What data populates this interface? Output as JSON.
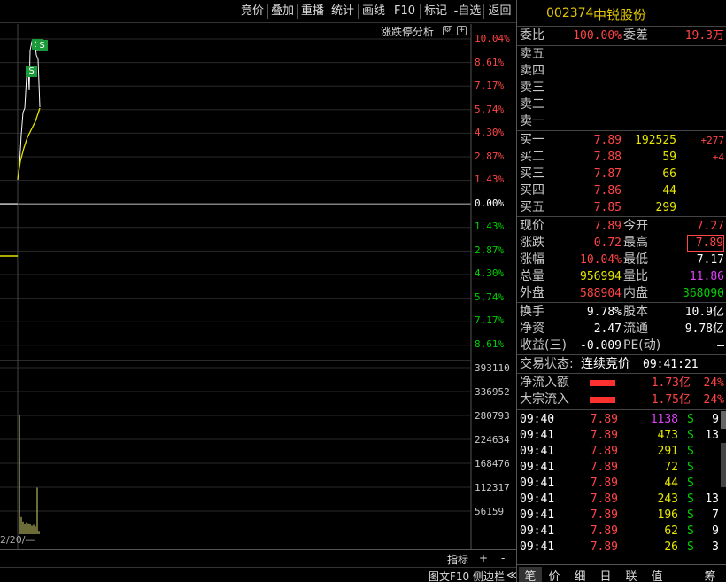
{
  "toolbar": {
    "buttons": [
      "竞价",
      "叠加",
      "重播",
      "统计",
      "画线",
      "F10",
      "标记",
      "-自选",
      "返回"
    ]
  },
  "chart": {
    "title": "涨跌停分析",
    "price_labels_up": [
      "10.04%",
      "8.61%",
      "7.17%",
      "5.74%",
      "4.30%",
      "2.87%",
      "1.43%"
    ],
    "price_label_zero": "0.00%",
    "price_labels_down": [
      "1.43%",
      "2.87%",
      "4.30%",
      "5.74%",
      "7.17%",
      "8.61%"
    ],
    "volume_labels": [
      "393110",
      "336952",
      "280793",
      "224634",
      "168476",
      "112317",
      "56159"
    ],
    "date_label": "2/20/—",
    "marker_s": "S",
    "colors": {
      "up": "#ff4545",
      "down": "#00d000",
      "price_line": "#ffffff",
      "avg_line": "#e6e600",
      "vol": "#d8d870"
    }
  },
  "bottom_bar": {
    "indicator": "指标",
    "plus": "+",
    "minus": "-"
  },
  "bottom_strip": {
    "f10": "图文F10",
    "sidebar": "侧边栏",
    "arrows": "≪"
  },
  "stock": {
    "code": "002374",
    "name": "中锐股份"
  },
  "order_ratio": {
    "label": "委比",
    "value": "100.00%",
    "diff_label": "委差",
    "diff_value": "19.3万"
  },
  "sell": [
    {
      "label": "卖五"
    },
    {
      "label": "卖四"
    },
    {
      "label": "卖三"
    },
    {
      "label": "卖二"
    },
    {
      "label": "卖一"
    }
  ],
  "buy": [
    {
      "label": "买一",
      "price": "7.89",
      "vol": "192525",
      "chg": "+277"
    },
    {
      "label": "买二",
      "price": "7.88",
      "vol": "59",
      "chg": "+4"
    },
    {
      "label": "买三",
      "price": "7.87",
      "vol": "66",
      "chg": ""
    },
    {
      "label": "买四",
      "price": "7.86",
      "vol": "44",
      "chg": ""
    },
    {
      "label": "买五",
      "price": "7.85",
      "vol": "299",
      "chg": ""
    }
  ],
  "quote": [
    {
      "l1": "现价",
      "v1": "7.89",
      "l2": "今开",
      "v2": "7.27"
    },
    {
      "l1": "涨跌",
      "v1": "0.72",
      "l2": "最高",
      "v2": "7.89"
    },
    {
      "l1": "涨幅",
      "v1": "10.04%",
      "l2": "最低",
      "v2": "7.17"
    },
    {
      "l1": "总量",
      "v1": "956994",
      "l2": "量比",
      "v2": "11.86"
    },
    {
      "l1": "外盘",
      "v1": "588904",
      "l2": "内盘",
      "v2": "368090"
    }
  ],
  "fundamentals": [
    {
      "l1": "换手",
      "v1": "9.78%",
      "l2": "股本",
      "v2": "10.9亿"
    },
    {
      "l1": "净资",
      "v1": "2.47",
      "l2": "流通",
      "v2": "9.78亿"
    },
    {
      "l1": "收益(三)",
      "v1": "-0.009",
      "l2": "PE(动)",
      "v2": "—"
    }
  ],
  "trade_status": {
    "label": "交易状态:",
    "value": "连续竞价",
    "time": "09:41:21"
  },
  "flows": [
    {
      "label": "净流入额",
      "value": "1.73亿",
      "pct": "24%",
      "fill": 0.24
    },
    {
      "label": "大宗流入",
      "value": "1.75亿",
      "pct": "24%",
      "fill": 0.24
    }
  ],
  "ticks": [
    {
      "time": "09:40",
      "price": "7.89",
      "vol": "1138",
      "side": "S",
      "n": "9"
    },
    {
      "time": "09:41",
      "price": "7.89",
      "vol": "473",
      "side": "S",
      "n": "13"
    },
    {
      "time": "09:41",
      "price": "7.89",
      "vol": "291",
      "side": "S",
      "n": ""
    },
    {
      "time": "09:41",
      "price": "7.89",
      "vol": "72",
      "side": "S",
      "n": ""
    },
    {
      "time": "09:41",
      "price": "7.89",
      "vol": "44",
      "side": "S",
      "n": ""
    },
    {
      "time": "09:41",
      "price": "7.89",
      "vol": "243",
      "side": "S",
      "n": "13"
    },
    {
      "time": "09:41",
      "price": "7.89",
      "vol": "196",
      "side": "S",
      "n": "7"
    },
    {
      "time": "09:41",
      "price": "7.89",
      "vol": "62",
      "side": "S",
      "n": "9"
    },
    {
      "time": "09:41",
      "price": "7.89",
      "vol": "26",
      "side": "S",
      "n": "3"
    }
  ],
  "tabs": [
    "笔",
    "价",
    "细",
    "日",
    "联",
    "值",
    "筹"
  ]
}
